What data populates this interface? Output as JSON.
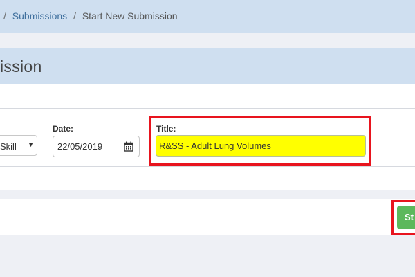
{
  "breadcrumb": {
    "separator": "/",
    "items": [
      {
        "label": "Submissions"
      },
      {
        "label": "Start New Submission"
      }
    ]
  },
  "page": {
    "title": "ission"
  },
  "form": {
    "type_select": {
      "value": "Skill",
      "chevron": "▼"
    },
    "date": {
      "label": "Date:",
      "value": "22/05/2019",
      "icon": "calendar-icon"
    },
    "title": {
      "label": "Title:",
      "value": "R&SS - Adult Lung Volumes",
      "highlight_color": "#ffff00"
    }
  },
  "actions": {
    "start_label": "St"
  },
  "colors": {
    "header_bg": "#cfdff0",
    "page_bg": "#eef0f5",
    "annotation_red": "#e8141e",
    "success_green": "#5cb85c",
    "link_blue": "#3f6f9d"
  }
}
